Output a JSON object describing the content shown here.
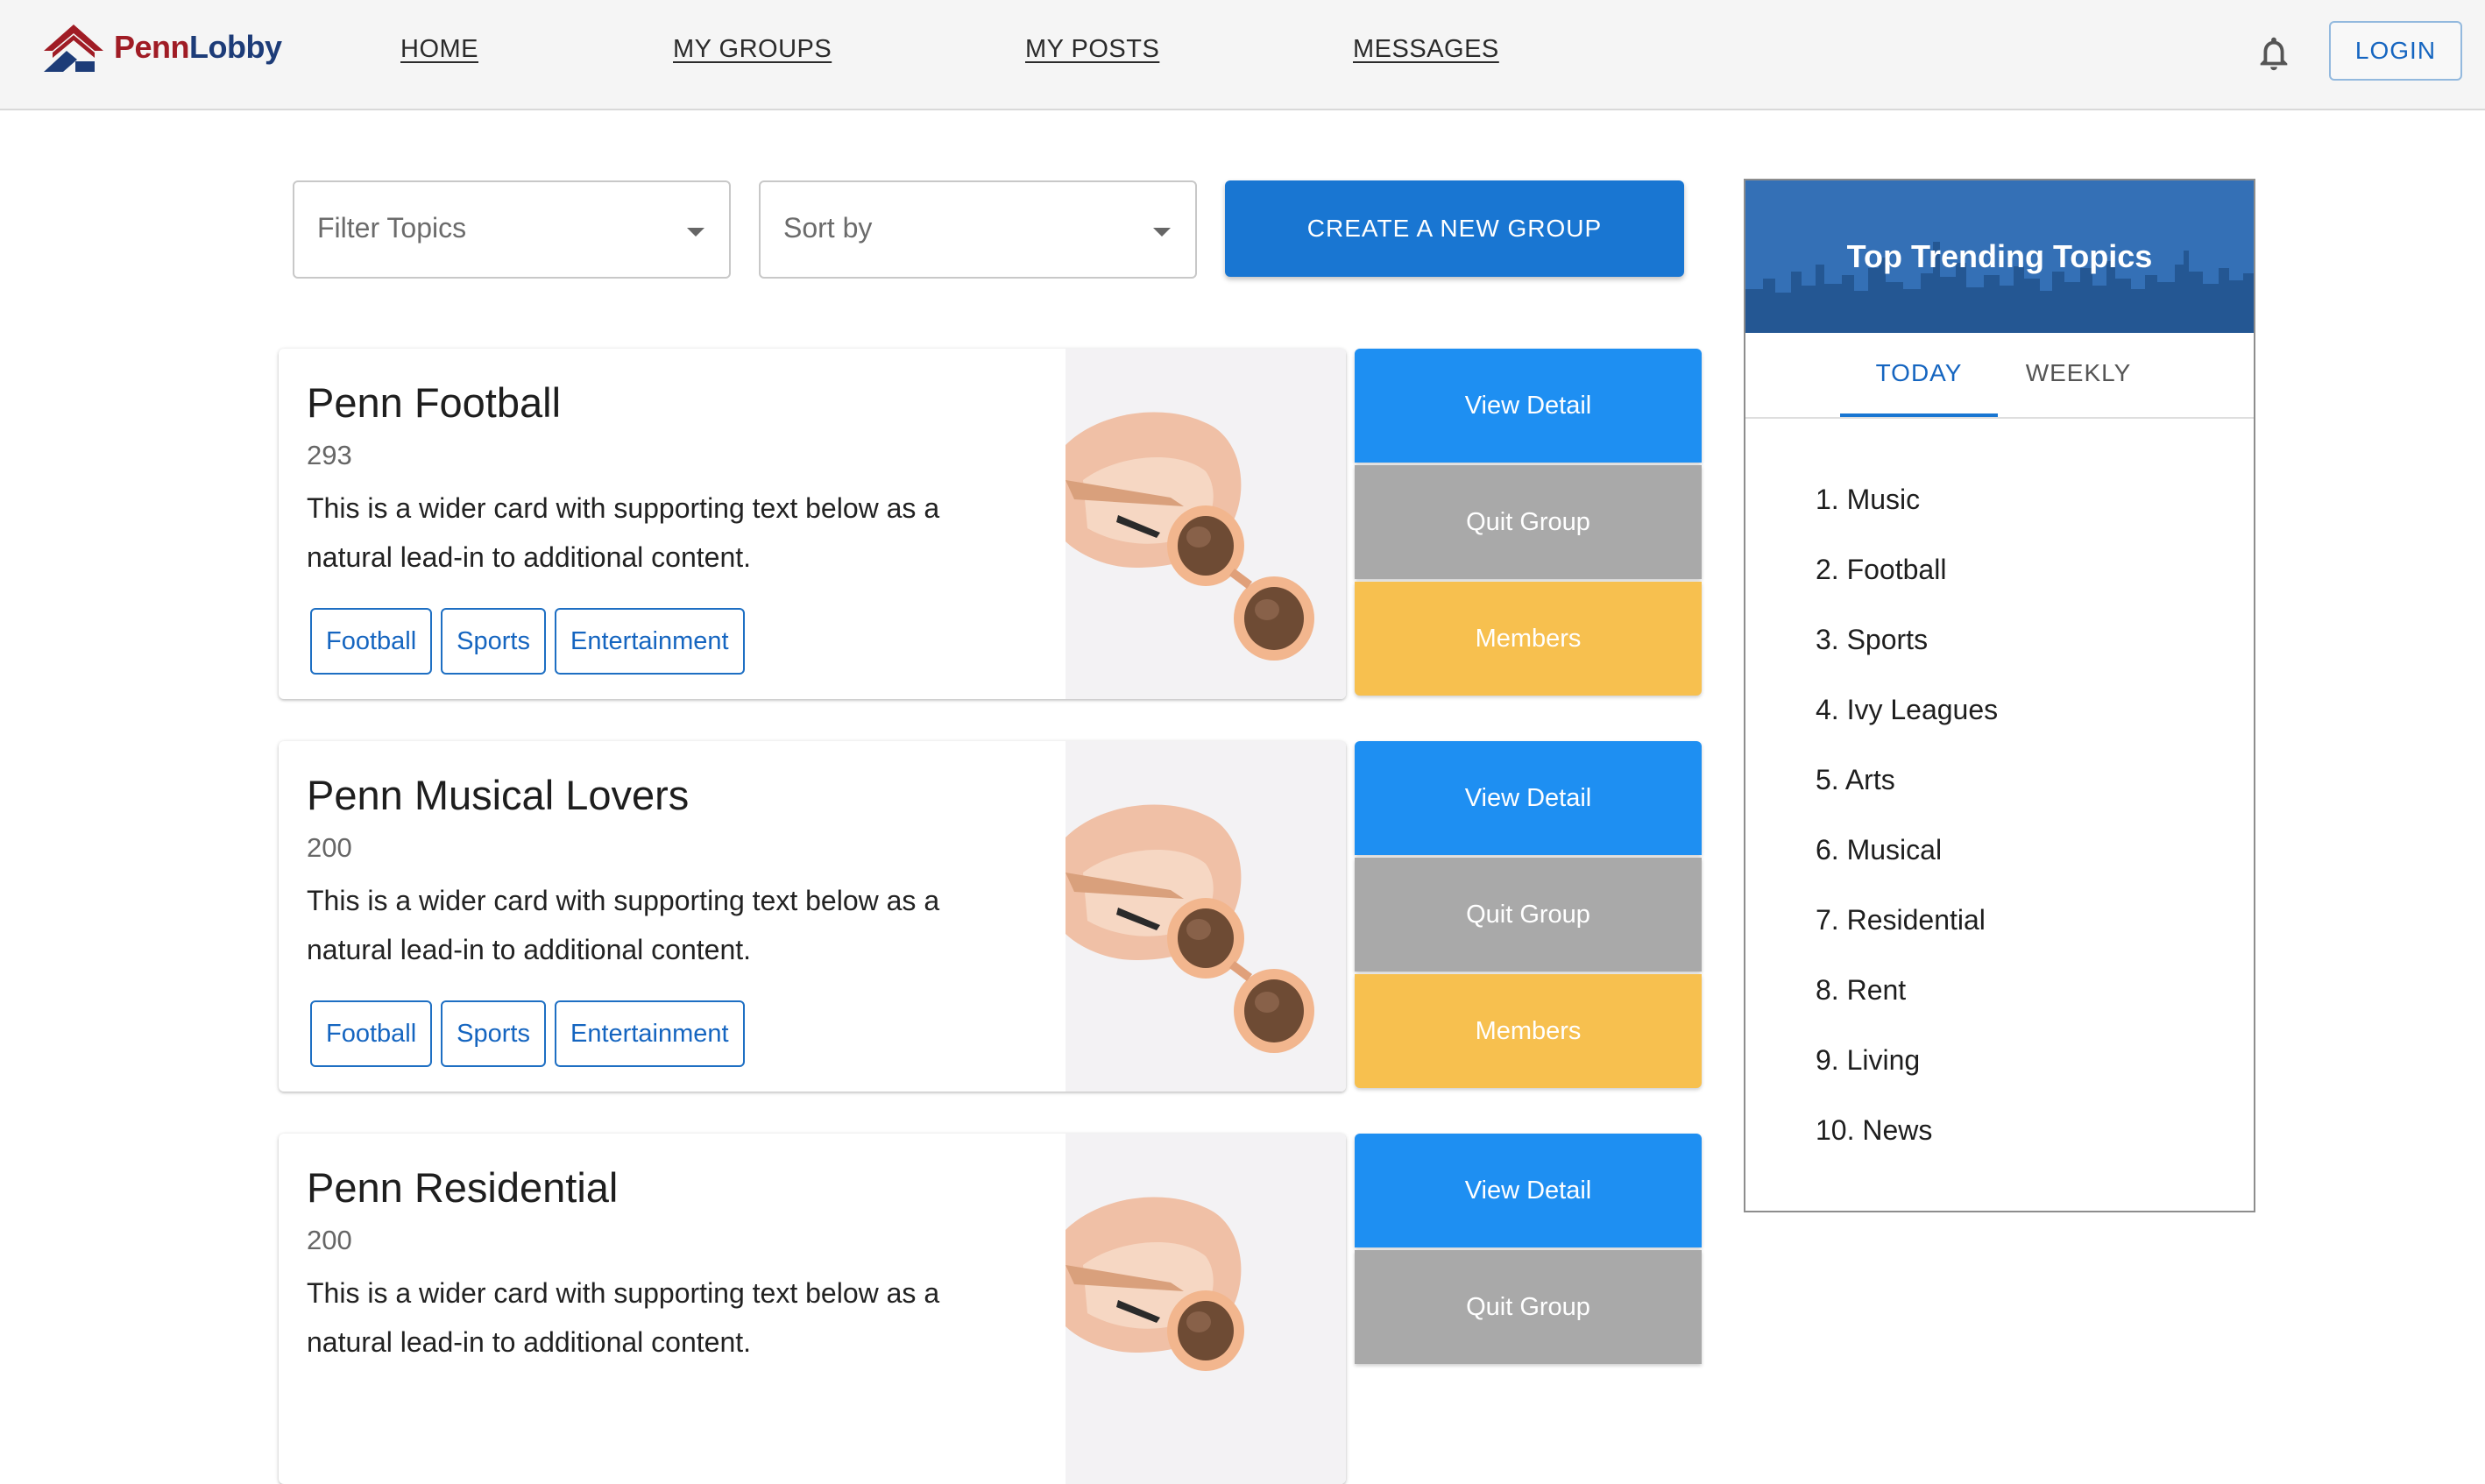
{
  "header": {
    "logo_part1": "Penn",
    "logo_part2": "Lobby",
    "nav": [
      "HOME",
      "MY GROUPS",
      "MY POSTS",
      "MESSAGES"
    ],
    "notification_icon": "bell-icon",
    "login_label": "LOGIN"
  },
  "toolbar": {
    "filter_placeholder": "Filter Topics",
    "sort_placeholder": "Sort by",
    "create_label": "CREATE A NEW GROUP"
  },
  "groups": [
    {
      "name": "Penn Football",
      "count": "293",
      "description": "This is a wider card with supporting text below as a natural lead-in to additional content.",
      "tags": [
        "Football",
        "Sports",
        "Entertainment"
      ],
      "view_label": "View Detail",
      "quit_label": "Quit Group",
      "members_label": "Members"
    },
    {
      "name": "Penn Musical Lovers",
      "count": "200",
      "description": "This is a wider card with supporting text below as a natural lead-in to additional content.",
      "tags": [
        "Football",
        "Sports",
        "Entertainment"
      ],
      "view_label": "View Detail",
      "quit_label": "Quit Group",
      "members_label": "Members"
    },
    {
      "name": "Penn Residential",
      "count": "200",
      "description": "This is a wider card with supporting text below as a natural lead-in to additional content.",
      "view_label": "View Detail",
      "quit_label": "Quit Group"
    }
  ],
  "trending": {
    "title": "Top Trending Topics",
    "tabs": [
      "TODAY",
      "WEEKLY"
    ],
    "active_tab": "TODAY",
    "topics": [
      "1. Music",
      "2. Football",
      "3. Sports",
      "4. Ivy Leagues",
      "5. Arts",
      "6. Musical",
      "7. Residential",
      "8. Rent",
      "9. Living",
      "10. News"
    ]
  },
  "colors": {
    "primary": "#1976d2",
    "view_button": "#1e8ff2",
    "quit_button": "#a9a9a9",
    "members_button": "#f7c04f",
    "logo_red": "#a01c25",
    "logo_navy": "#1d3c78"
  }
}
